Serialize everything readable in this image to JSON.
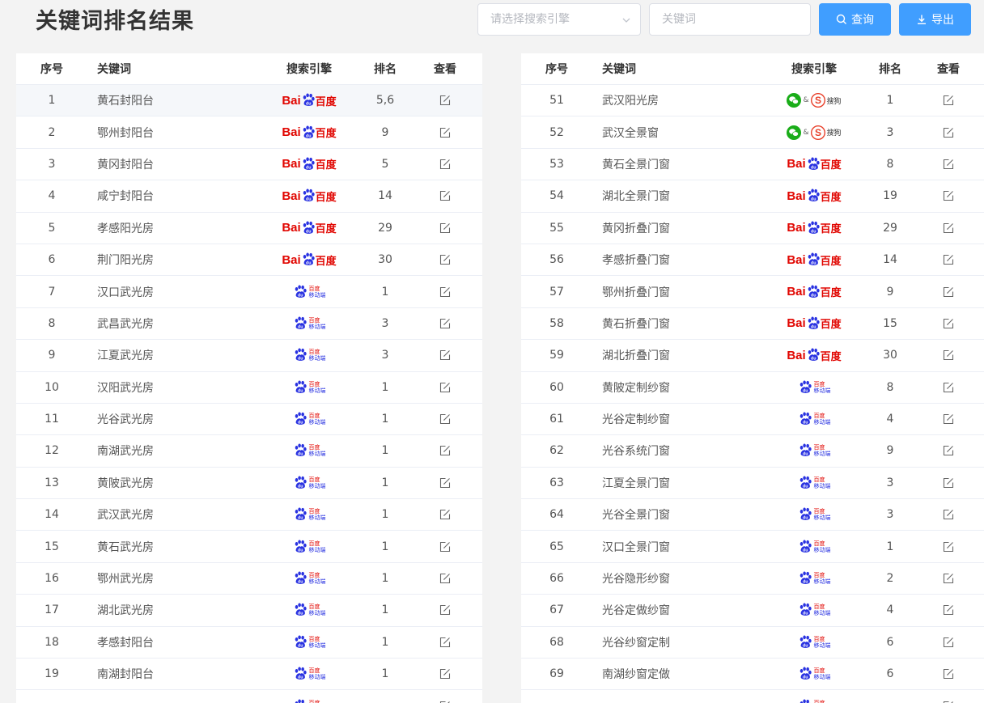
{
  "page": {
    "title": "关键词排名结果"
  },
  "toolbar": {
    "engine_placeholder": "请选择搜索引擎",
    "keyword_placeholder": "关键词",
    "query_label": "查询",
    "export_label": "导出"
  },
  "columns": {
    "idx": "序号",
    "keyword": "关键词",
    "engine": "搜索引擎",
    "rank": "排名",
    "view": "查看"
  },
  "logos": {
    "baidu_bai": "Bai",
    "baidu_zh": "百度",
    "mobile_a": "百度",
    "mobile_b": "移动端",
    "wechat_amp": "&",
    "sogou": "搜狗",
    "colors": {
      "baidu_red": "#e10601",
      "baidu_blue": "#2932e1",
      "wechat_green": "#1aad19",
      "sogou_red": "#e8402b",
      "primary": "#409eff"
    }
  },
  "left_rows": [
    {
      "idx": "1",
      "kw": "黄石封阳台",
      "engine": "baidu",
      "rank": "5,6"
    },
    {
      "idx": "2",
      "kw": "鄂州封阳台",
      "engine": "baidu",
      "rank": "9"
    },
    {
      "idx": "3",
      "kw": "黄冈封阳台",
      "engine": "baidu",
      "rank": "5"
    },
    {
      "idx": "4",
      "kw": "咸宁封阳台",
      "engine": "baidu",
      "rank": "14"
    },
    {
      "idx": "5",
      "kw": "孝感阳光房",
      "engine": "baidu",
      "rank": "29"
    },
    {
      "idx": "6",
      "kw": "荆门阳光房",
      "engine": "baidu",
      "rank": "30"
    },
    {
      "idx": "7",
      "kw": "汉口武光房",
      "engine": "mobile",
      "rank": "1"
    },
    {
      "idx": "8",
      "kw": "武昌武光房",
      "engine": "mobile",
      "rank": "3"
    },
    {
      "idx": "9",
      "kw": "江夏武光房",
      "engine": "mobile",
      "rank": "3"
    },
    {
      "idx": "10",
      "kw": "汉阳武光房",
      "engine": "mobile",
      "rank": "1"
    },
    {
      "idx": "11",
      "kw": "光谷武光房",
      "engine": "mobile",
      "rank": "1"
    },
    {
      "idx": "12",
      "kw": "南湖武光房",
      "engine": "mobile",
      "rank": "1"
    },
    {
      "idx": "13",
      "kw": "黄陂武光房",
      "engine": "mobile",
      "rank": "1"
    },
    {
      "idx": "14",
      "kw": "武汉武光房",
      "engine": "mobile",
      "rank": "1"
    },
    {
      "idx": "15",
      "kw": "黄石武光房",
      "engine": "mobile",
      "rank": "1"
    },
    {
      "idx": "16",
      "kw": "鄂州武光房",
      "engine": "mobile",
      "rank": "1"
    },
    {
      "idx": "17",
      "kw": "湖北武光房",
      "engine": "mobile",
      "rank": "1"
    },
    {
      "idx": "18",
      "kw": "孝感封阳台",
      "engine": "mobile",
      "rank": "1"
    },
    {
      "idx": "19",
      "kw": "南湖封阳台",
      "engine": "mobile",
      "rank": "1"
    },
    {
      "idx": "",
      "kw": "",
      "engine": "mobile",
      "rank": ""
    }
  ],
  "right_rows": [
    {
      "idx": "51",
      "kw": "武汉阳光房",
      "engine": "wechat",
      "rank": "1"
    },
    {
      "idx": "52",
      "kw": "武汉全景窗",
      "engine": "wechat",
      "rank": "3"
    },
    {
      "idx": "53",
      "kw": "黄石全景门窗",
      "engine": "baidu",
      "rank": "8"
    },
    {
      "idx": "54",
      "kw": "湖北全景门窗",
      "engine": "baidu",
      "rank": "19"
    },
    {
      "idx": "55",
      "kw": "黄冈折叠门窗",
      "engine": "baidu",
      "rank": "29"
    },
    {
      "idx": "56",
      "kw": "孝感折叠门窗",
      "engine": "baidu",
      "rank": "14"
    },
    {
      "idx": "57",
      "kw": "鄂州折叠门窗",
      "engine": "baidu",
      "rank": "9"
    },
    {
      "idx": "58",
      "kw": "黄石折叠门窗",
      "engine": "baidu",
      "rank": "15"
    },
    {
      "idx": "59",
      "kw": "湖北折叠门窗",
      "engine": "baidu",
      "rank": "30"
    },
    {
      "idx": "60",
      "kw": "黄陂定制纱窗",
      "engine": "mobile",
      "rank": "8"
    },
    {
      "idx": "61",
      "kw": "光谷定制纱窗",
      "engine": "mobile",
      "rank": "4"
    },
    {
      "idx": "62",
      "kw": "光谷系统门窗",
      "engine": "mobile",
      "rank": "9"
    },
    {
      "idx": "63",
      "kw": "江夏全景门窗",
      "engine": "mobile",
      "rank": "3"
    },
    {
      "idx": "64",
      "kw": "光谷全景门窗",
      "engine": "mobile",
      "rank": "3"
    },
    {
      "idx": "65",
      "kw": "汉口全景门窗",
      "engine": "mobile",
      "rank": "1"
    },
    {
      "idx": "66",
      "kw": "光谷隐形纱窗",
      "engine": "mobile",
      "rank": "2"
    },
    {
      "idx": "67",
      "kw": "光谷定做纱窗",
      "engine": "mobile",
      "rank": "4"
    },
    {
      "idx": "68",
      "kw": "光谷纱窗定制",
      "engine": "mobile",
      "rank": "6"
    },
    {
      "idx": "69",
      "kw": "南湖纱窗定做",
      "engine": "mobile",
      "rank": "6"
    },
    {
      "idx": "",
      "kw": "",
      "engine": "mobile",
      "rank": ""
    }
  ]
}
